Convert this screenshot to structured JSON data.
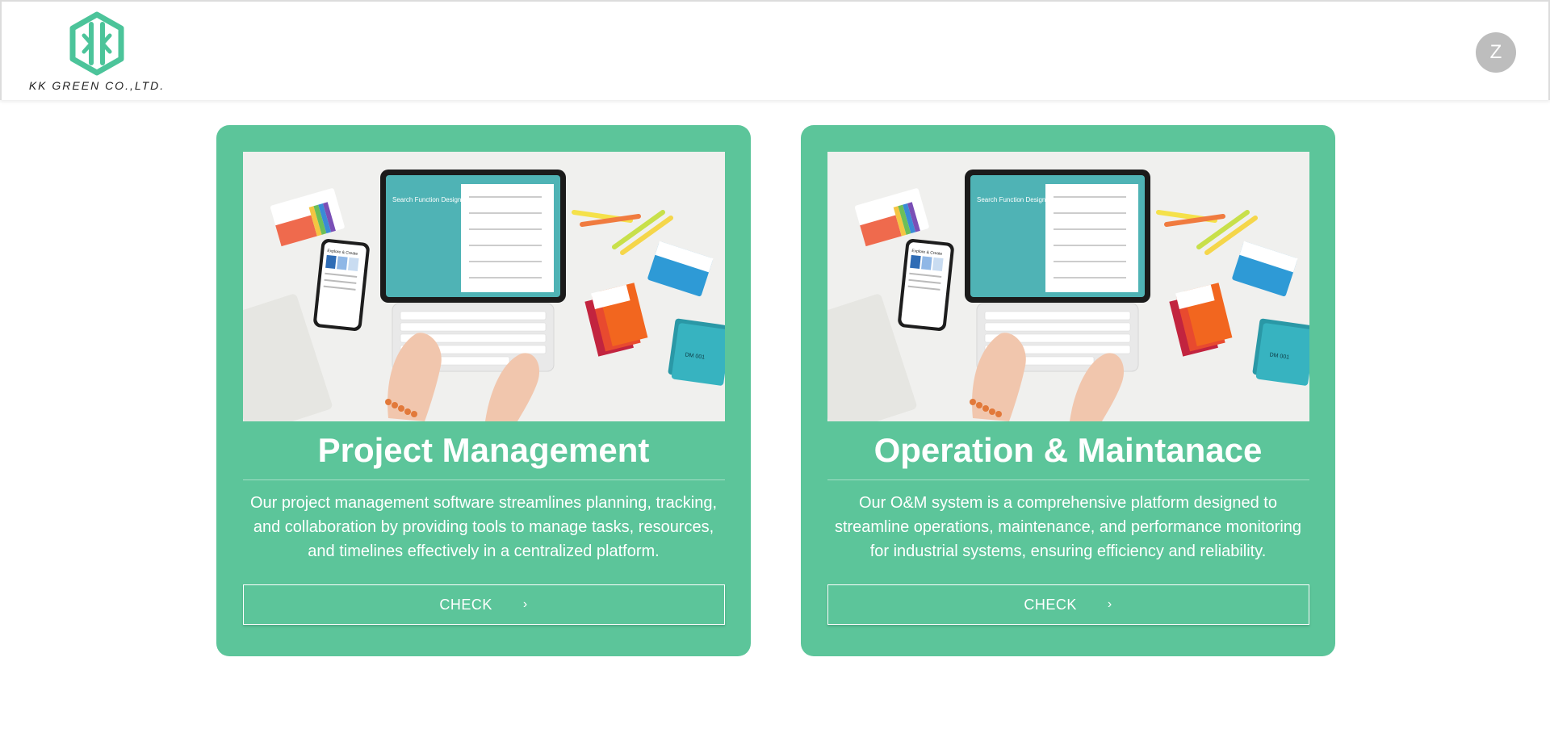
{
  "header": {
    "company_name": "KK GREEN CO.,LTD.",
    "avatar_initial": "Z"
  },
  "cards": [
    {
      "title": "Project Management",
      "description": "Our project management software streamlines planning, tracking, and collaboration by providing tools to manage tasks, resources, and timelines effectively in a centralized platform.",
      "button_label": "CHECK",
      "button_icon": "chevron-right-icon",
      "image_text": {
        "screen_title": "Search Function Design & Consideration",
        "phone_title": "Explore & Create",
        "card_label": "DM 001"
      }
    },
    {
      "title": "Operation & Maintanace",
      "description": "Our O&M system is a comprehensive platform designed to streamline operations, maintenance, and performance monitoring for industrial systems, ensuring efficiency and reliability.",
      "button_label": "CHECK",
      "button_icon": "chevron-right-icon",
      "image_text": {
        "screen_title": "Search Function Design & Consideration",
        "phone_title": "Explore & Create",
        "card_label": "DM 001"
      }
    }
  ],
  "colors": {
    "brand_green": "#5cc59a",
    "logo_green": "#4cc49a",
    "avatar_gray": "#bdbdbd"
  }
}
